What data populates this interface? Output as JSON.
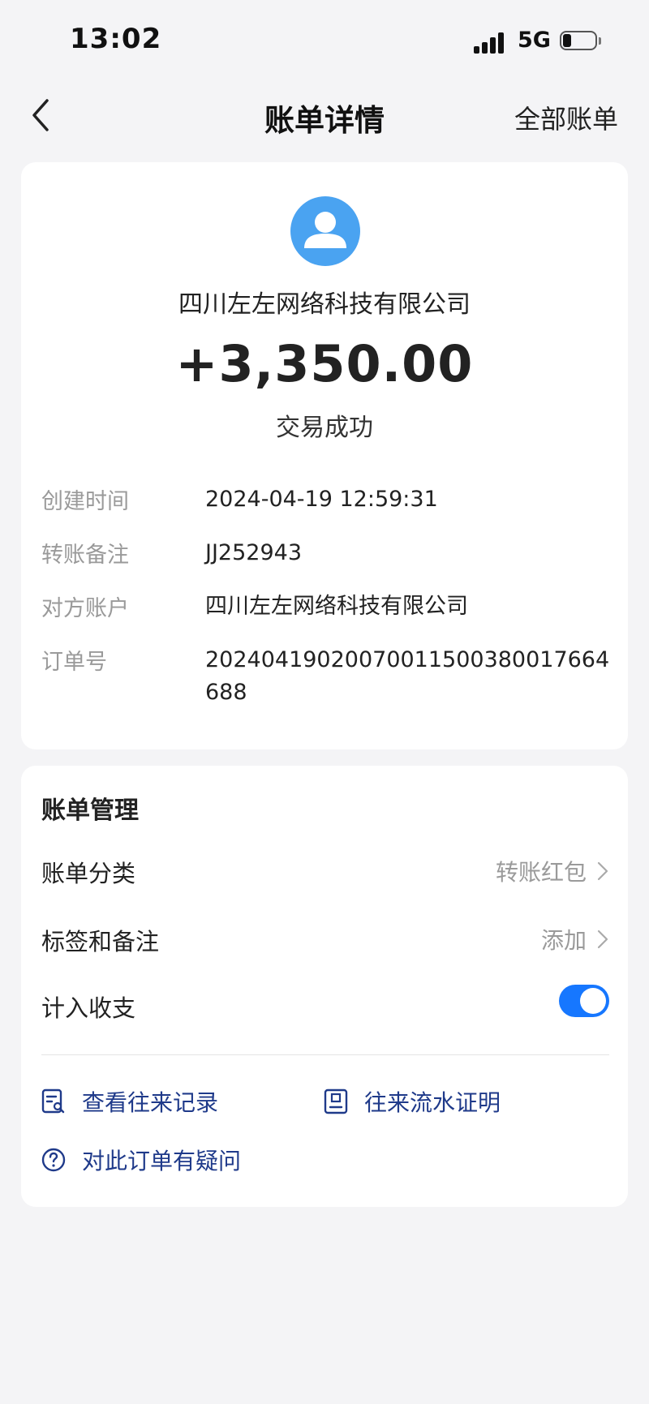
{
  "status_bar": {
    "time": "13:02",
    "network": "5G"
  },
  "nav": {
    "title": "账单详情",
    "right_link": "全部账单"
  },
  "transaction": {
    "counterparty": "四川左左网络科技有限公司",
    "amount": "+3,350.00",
    "status": "交易成功"
  },
  "details": [
    {
      "label": "创建时间",
      "value": "2024-04-19 12:59:31"
    },
    {
      "label": "转账备注",
      "value": "JJ252943"
    },
    {
      "label": "对方账户",
      "value": "四川左左网络科技有限公司"
    },
    {
      "label": "订单号",
      "value": "20240419020070011500380017664688"
    }
  ],
  "management": {
    "title": "账单管理",
    "category": {
      "label": "账单分类",
      "value": "转账红包"
    },
    "tags": {
      "label": "标签和备注",
      "value": "添加"
    },
    "include_in_budget": {
      "label": "计入收支",
      "enabled": true
    }
  },
  "links": {
    "history": "查看往来记录",
    "proof": "往来流水证明",
    "question": "对此订单有疑问"
  },
  "colors": {
    "accent": "#1677ff",
    "avatar": "#4aa3f1",
    "link": "#1f3a8a"
  }
}
